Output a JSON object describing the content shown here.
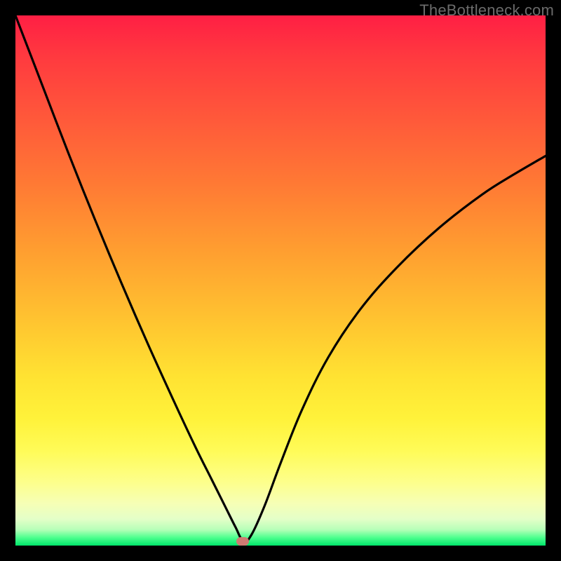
{
  "watermark": "TheBottleneck.com",
  "colors": {
    "border": "#000000",
    "curve": "#000000",
    "marker": "#cf7a72",
    "gradient_top": "#ff1f44",
    "gradient_mid": "#ffe232",
    "gradient_bottom": "#00e56a"
  },
  "marker": {
    "x_frac": 0.429,
    "y_frac": 0.992
  },
  "chart_data": {
    "type": "line",
    "title": "",
    "xlabel": "",
    "ylabel": "",
    "xlim": [
      0,
      1
    ],
    "ylim": [
      0,
      1
    ],
    "series": [
      {
        "name": "bottleneck-curve",
        "x": [
          0.0,
          0.05,
          0.1,
          0.15,
          0.2,
          0.25,
          0.3,
          0.34,
          0.37,
          0.395,
          0.415,
          0.43,
          0.445,
          0.47,
          0.5,
          0.54,
          0.59,
          0.65,
          0.72,
          0.8,
          0.88,
          0.94,
          1.0
        ],
        "y": [
          1.0,
          0.87,
          0.74,
          0.615,
          0.495,
          0.38,
          0.27,
          0.185,
          0.125,
          0.075,
          0.035,
          0.008,
          0.02,
          0.075,
          0.155,
          0.255,
          0.355,
          0.445,
          0.525,
          0.6,
          0.662,
          0.7,
          0.735
        ]
      }
    ],
    "markers": [
      {
        "name": "minimum",
        "x": 0.429,
        "y": 0.008
      }
    ]
  }
}
